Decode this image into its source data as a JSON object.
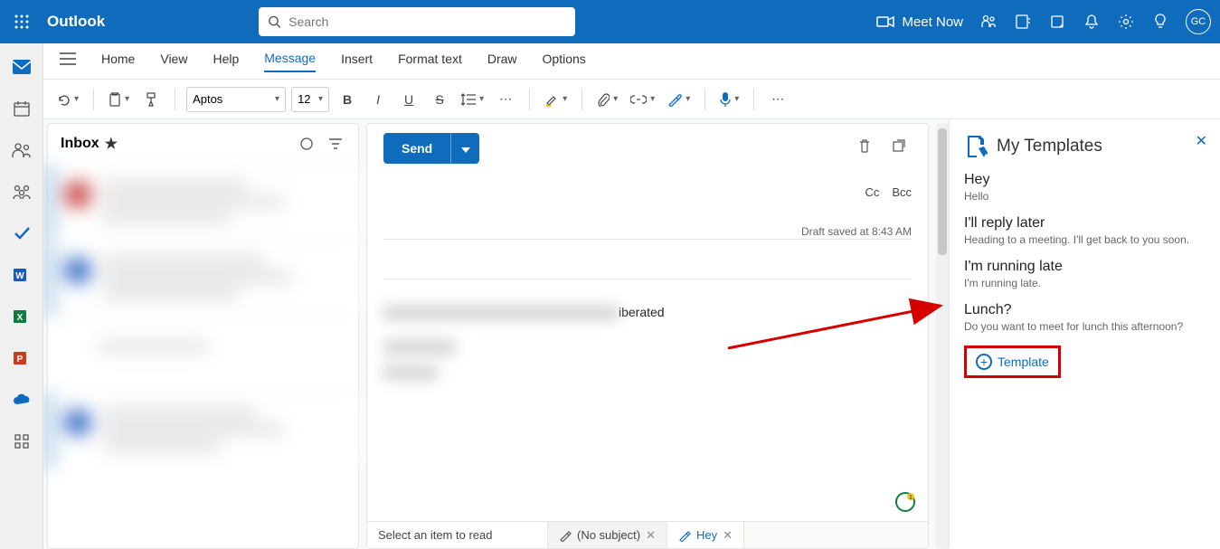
{
  "topbar": {
    "brand": "Outlook",
    "search_placeholder": "Search",
    "meet_now": "Meet Now",
    "avatar_initials": "GC"
  },
  "menu": {
    "items": [
      "Home",
      "View",
      "Help",
      "Message",
      "Insert",
      "Format text",
      "Draw",
      "Options"
    ],
    "active": "Message"
  },
  "ribbon": {
    "font_name": "Aptos",
    "font_size": "12"
  },
  "inbox": {
    "title": "Inbox"
  },
  "compose": {
    "send_label": "Send",
    "cc_label": "Cc",
    "bcc_label": "Bcc",
    "draft_status": "Draft saved at 8:43 AM",
    "body_fragment": "iberated"
  },
  "bottom_tabs": {
    "placeholder": "Select an item to read",
    "tab1": "(No subject)",
    "tab2": "Hey"
  },
  "templates": {
    "title": "My Templates",
    "items": [
      {
        "title": "Hey",
        "subtitle": "Hello"
      },
      {
        "title": "I'll reply later",
        "subtitle": "Heading to a meeting. I'll get back to you soon."
      },
      {
        "title": "I'm running late",
        "subtitle": "I'm running late."
      },
      {
        "title": "Lunch?",
        "subtitle": "Do you want to meet for lunch this afternoon?"
      }
    ],
    "add_label": "Template"
  }
}
